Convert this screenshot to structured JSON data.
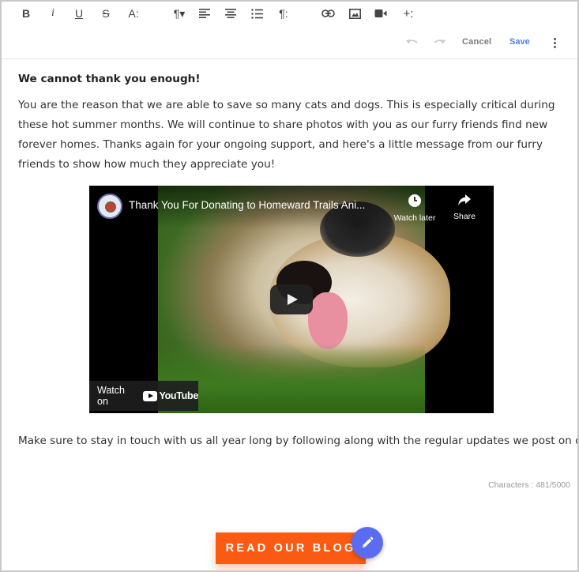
{
  "toolbar": {
    "buttons": [
      {
        "name": "bold-button",
        "glyph": "B"
      },
      {
        "name": "italic-button",
        "glyph": "i"
      },
      {
        "name": "underline-button",
        "glyph": "U"
      },
      {
        "name": "strikethrough-button",
        "glyph": "S"
      },
      {
        "name": "font-size-button",
        "glyph": "A:"
      },
      {
        "name": "paragraph-format-button",
        "glyph": "¶▾"
      },
      {
        "name": "align-left-button",
        "icon": "align-left-icon"
      },
      {
        "name": "align-center-button",
        "icon": "align-center-icon"
      },
      {
        "name": "ordered-list-button",
        "icon": "ordered-list-icon"
      },
      {
        "name": "paragraph-style-button",
        "glyph": "¶:"
      },
      {
        "name": "insert-link-button",
        "icon": "link-icon"
      },
      {
        "name": "insert-image-button",
        "icon": "image-icon"
      },
      {
        "name": "insert-video-button",
        "icon": "video-icon"
      },
      {
        "name": "insert-more-button",
        "glyph": "+:"
      }
    ]
  },
  "actions": {
    "cancel_label": "Cancel",
    "save_label": "Save",
    "undo_icon": "undo-icon",
    "redo_icon": "redo-icon",
    "more_icon": "more-vertical-icon"
  },
  "content": {
    "heading": "We cannot thank you enough!",
    "paragraph": "You are the reason that we are able to save so many cats and dogs. This is especially critical during these hot summer months. We will continue to share photos with you as our furry friends find new forever homes. Thanks again for your ongoing support, and here's a little message from our furry friends to show how much they appreciate you!",
    "closing": "Make sure to stay in touch with us all year long by following along with the regular updates we post on our blog!"
  },
  "video": {
    "title": "Thank You For Donating to Homeward Trails Ani...",
    "watch_later_label": "Watch later",
    "share_label": "Share",
    "watch_on_label": "Watch on",
    "youtube_label": "YouTube"
  },
  "status": {
    "char_count": "Characters : 481/5000"
  },
  "cta": {
    "label": "READ OUR BLOG"
  },
  "colors": {
    "accent_save": "#4d7fe0",
    "cta_orange": "#fb5a12",
    "fab_blue": "#5b6cf0"
  }
}
